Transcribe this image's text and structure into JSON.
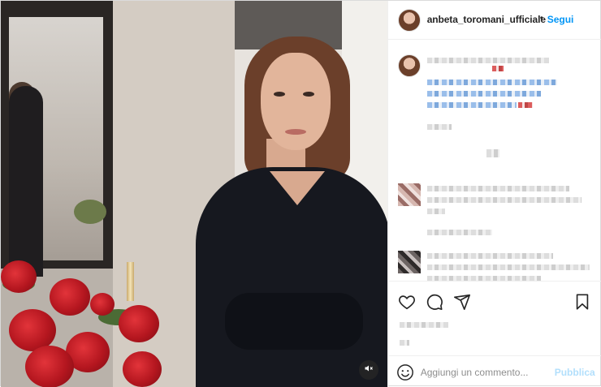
{
  "post": {
    "username": "anbeta_toromani_ufficiale",
    "separator": "•",
    "follow_label": "Segui"
  },
  "comment_box": {
    "placeholder": "Aggiungi un commento...",
    "publish_label": "Pubblica"
  },
  "colors": {
    "link_blue": "#0095f6",
    "publish_disabled": "#b2dffc",
    "text": "#262626",
    "muted": "#8e8e8e"
  },
  "icons": {
    "like": "heart-icon",
    "comment": "comment-icon",
    "share": "paper-plane-icon",
    "save": "bookmark-icon",
    "mute": "speaker-muted-icon",
    "emoji": "smiley-icon"
  }
}
